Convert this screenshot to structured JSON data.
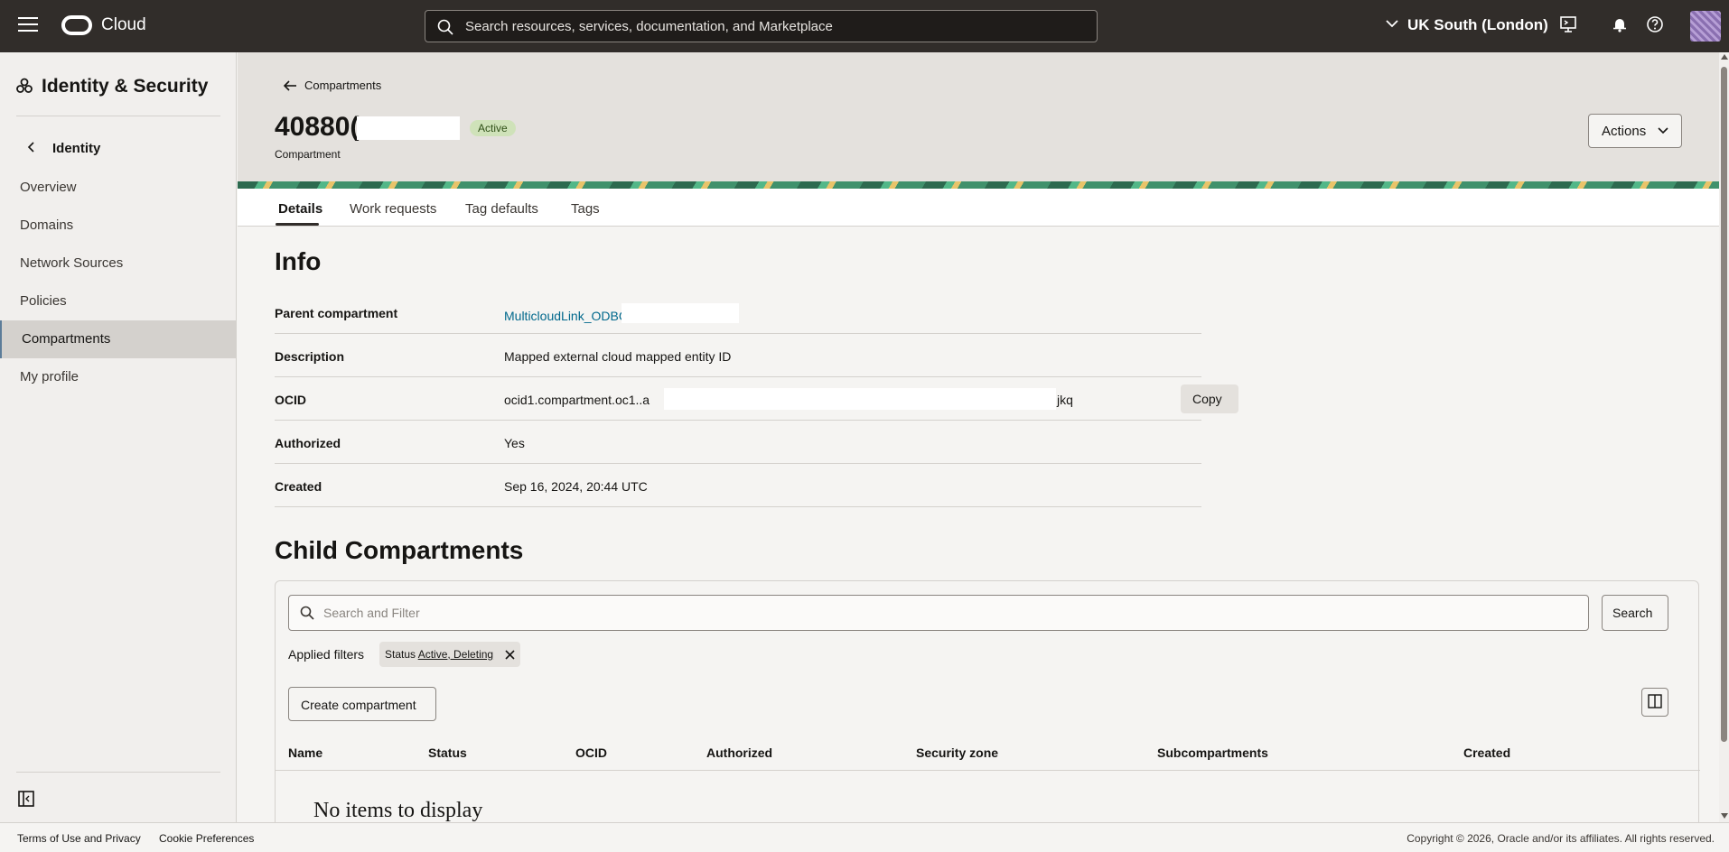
{
  "topbar": {
    "brand": "Cloud",
    "search_placeholder": "Search resources, services, documentation, and Marketplace",
    "region": "UK South (London)"
  },
  "sidebar": {
    "title": "Identity & Security",
    "back_label": "Identity",
    "items": [
      {
        "label": "Overview",
        "active": false
      },
      {
        "label": "Domains",
        "active": false
      },
      {
        "label": "Network Sources",
        "active": false
      },
      {
        "label": "Policies",
        "active": false
      },
      {
        "label": "Compartments",
        "active": true
      },
      {
        "label": "My profile",
        "active": false
      }
    ]
  },
  "header": {
    "back_link": "Compartments",
    "title": "40880(",
    "status": "Active",
    "subtitle": "Compartment",
    "actions_label": "Actions"
  },
  "tabs": [
    {
      "label": "Details",
      "active": true
    },
    {
      "label": "Work requests",
      "active": false
    },
    {
      "label": "Tag defaults",
      "active": false
    },
    {
      "label": "Tags",
      "active": false
    }
  ],
  "info": {
    "title": "Info",
    "rows": [
      {
        "label": "Parent compartment",
        "value": "MulticloudLink_ODBG_"
      },
      {
        "label": "Description",
        "value": "Mapped external cloud mapped entity ID"
      },
      {
        "label": "OCID",
        "value": "ocid1.compartment.oc1..a",
        "value_suffix": "jkq",
        "copy_label": "Copy"
      },
      {
        "label": "Authorized",
        "value": "Yes"
      },
      {
        "label": "Created",
        "value": "Sep 16, 2024, 20:44 UTC"
      }
    ]
  },
  "child": {
    "title": "Child Compartments",
    "filter_placeholder": "Search and Filter",
    "search_label": "Search",
    "applied_label": "Applied filters",
    "chip_key": "Status",
    "chip_value": "Active, Deleting",
    "create_label": "Create compartment",
    "columns": [
      "Name",
      "Status",
      "OCID",
      "Authorized",
      "Security zone",
      "Subcompartments",
      "Created"
    ],
    "empty": "No items to display"
  },
  "footer": {
    "terms": "Terms of Use and Privacy",
    "cookies": "Cookie Preferences",
    "copyright": "Copyright © 2026, Oracle and/or its affiliates. All rights reserved."
  }
}
